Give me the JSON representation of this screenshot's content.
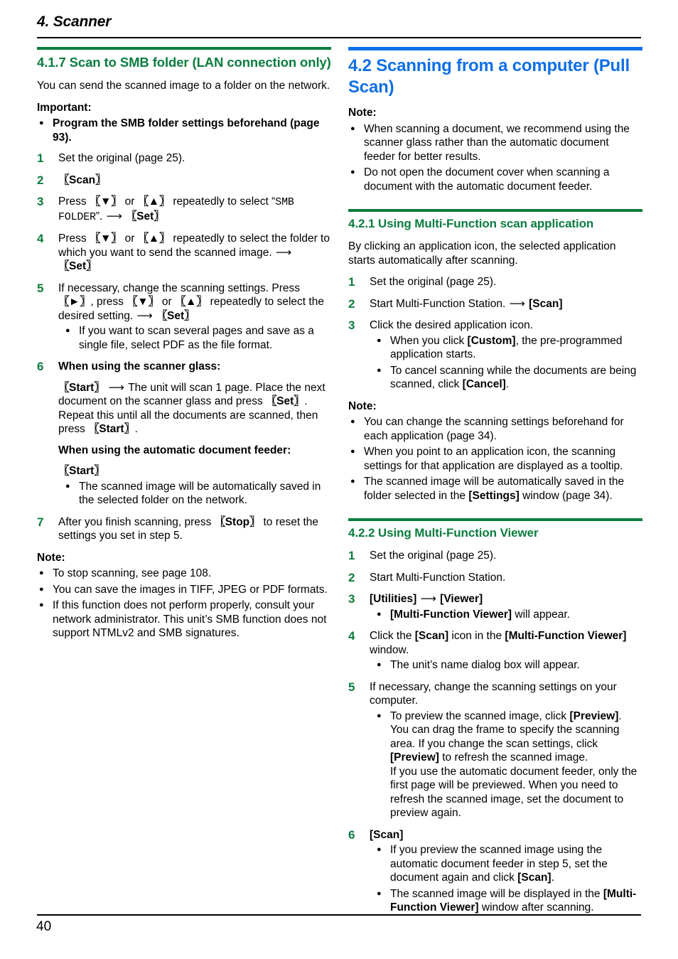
{
  "header": {
    "chapter_title": "4. Scanner"
  },
  "footer": {
    "page_number": "40"
  },
  "left_column": {
    "section_heading": "4.1.7 Scan to SMB folder (LAN connection only)",
    "intro": "You can send the scanned image to a folder on the network.",
    "important_label": "Important:",
    "important_bullets": [
      "Program the SMB folder settings beforehand (page 93)."
    ],
    "steps": [
      {
        "num": "1",
        "text": "Set the original (page 25)."
      },
      {
        "num": "2",
        "key": "Scan"
      },
      {
        "num": "3",
        "text_a": "Press ",
        "key_down": "▼",
        "mid_a": " or ",
        "key_up": "▲",
        "text_b": " repeatedly to select “",
        "lcd": "SMB FOLDER",
        "text_c": "”. ",
        "arrow": "⟶",
        "key_set": "Set"
      },
      {
        "num": "4",
        "text_a": "Press ",
        "key_down": "▼",
        "mid_a": " or ",
        "key_up": "▲",
        "text_b": " repeatedly to select the folder to which you want to send the scanned image. ",
        "arrow": "⟶",
        "key_set": "Set"
      },
      {
        "num": "5",
        "text_a": "If necessary, change the scanning settings. Press ",
        "key_right": "►",
        "mid_a": ", press ",
        "key_down": "▼",
        "mid_b": " or ",
        "key_up": "▲",
        "text_b": " repeatedly to select the desired setting. ",
        "arrow": "⟶",
        "key_set": "Set",
        "bullets": [
          "If you want to scan several pages and save as a single file, select PDF as the file format."
        ]
      },
      {
        "num": "6",
        "heading_glass": "When using the scanner glass:",
        "glass_key_start": "Start",
        "glass_arrow": "⟶",
        "glass_text_a": " The unit will scan 1 page. Place the next document on the scanner glass and press ",
        "glass_key_set": "Set",
        "glass_text_b": ". Repeat this until all the documents are scanned, then press ",
        "glass_key_start2": "Start",
        "glass_text_c": ".",
        "heading_adf": "When using the automatic document feeder:",
        "adf_key_start": "Start",
        "bullets": [
          "The scanned image will be automatically saved in the selected folder on the network."
        ]
      },
      {
        "num": "7",
        "text_a": "After you finish scanning, press ",
        "key_stop": "Stop",
        "text_b": " to reset the settings you set in step 5."
      }
    ],
    "note_label": "Note:",
    "note_bullets": [
      "To stop scanning, see page 108.",
      "You can save the images in TIFF, JPEG or PDF formats.",
      "If this function does not perform properly, consult your network administrator. This unit’s SMB function does not support NTMLv2 and SMB signatures."
    ]
  },
  "right_column": {
    "section_heading": "4.2 Scanning from a computer (Pull Scan)",
    "note_label_top": "Note:",
    "note_bullets_top": [
      "When scanning a document, we recommend using the scanner glass rather than the automatic document feeder for better results.",
      "Do not open the document cover when scanning a document with the automatic document feeder."
    ],
    "subsection_1": {
      "heading": "4.2.1 Using Multi-Function scan application",
      "intro": "By clicking an application icon, the selected application starts automatically after scanning.",
      "steps": [
        {
          "num": "1",
          "text": "Set the original (page 25)."
        },
        {
          "num": "2",
          "text_a": "Start Multi-Function Station. ",
          "arrow": "⟶",
          "bracket": "[Scan]"
        },
        {
          "num": "3",
          "text": "Click the desired application icon.",
          "bullets": [
            {
              "pre": "When you click ",
              "bold": "[Custom]",
              "post": ", the pre-programmed application starts."
            },
            {
              "pre": "To cancel scanning while the documents are being scanned, click ",
              "bold": "[Cancel]",
              "post": "."
            }
          ]
        }
      ],
      "note_label": "Note:",
      "note_bullets": [
        {
          "pre": "You can change the scanning settings beforehand for each application (page 34).",
          "bold": "",
          "post": ""
        },
        {
          "pre": "When you point to an application icon, the scanning settings for that application are displayed as a tooltip.",
          "bold": "",
          "post": ""
        },
        {
          "pre": "The scanned image will be automatically saved in the folder selected in the ",
          "bold": "[Settings]",
          "post": " window (page 34)."
        }
      ]
    },
    "subsection_2": {
      "heading": "4.2.2 Using Multi-Function Viewer",
      "steps": [
        {
          "num": "1",
          "text": "Set the original (page 25)."
        },
        {
          "num": "2",
          "text": "Start Multi-Function Station."
        },
        {
          "num": "3",
          "bold_a": "[Utilities]",
          "arrow": "⟶",
          "bold_b": "[Viewer]",
          "bullets": [
            {
              "pre": "",
              "bold": "[Multi-Function Viewer]",
              "post": " will appear."
            }
          ]
        },
        {
          "num": "4",
          "pre": "Click the ",
          "bold_a": "[Scan]",
          "mid": " icon in the ",
          "bold_b": "[Multi-Function Viewer]",
          "post": " window.",
          "bullets": [
            {
              "pre": "The unit’s name dialog box will appear.",
              "bold": "",
              "post": ""
            }
          ]
        },
        {
          "num": "5",
          "text": "If necessary, change the scanning settings on your computer.",
          "bullets": [
            {
              "pre": "To preview the scanned image, click ",
              "bold": "[Preview]",
              "mid": ". You can drag the frame to specify the scanning area. If you change the scan settings, click ",
              "bold2": "[Preview]",
              "post": " to refresh the scanned image.",
              "extra": "If you use the automatic document feeder, only the first page will be previewed. When you need to refresh the scanned image, set the document to preview again."
            }
          ]
        },
        {
          "num": "6",
          "bracket": "[Scan]",
          "bullets": [
            {
              "pre": "If you preview the scanned image using the automatic document feeder in step 5, set the document again and click ",
              "bold": "[Scan]",
              "post": "."
            },
            {
              "pre": "The scanned image will be displayed in the ",
              "bold": "[Multi-Function Viewer]",
              "post": " window after scanning."
            }
          ]
        }
      ]
    }
  },
  "colors": {
    "green": "#0a7d3e",
    "blue": "#0f6fe8",
    "text": "#000000"
  }
}
